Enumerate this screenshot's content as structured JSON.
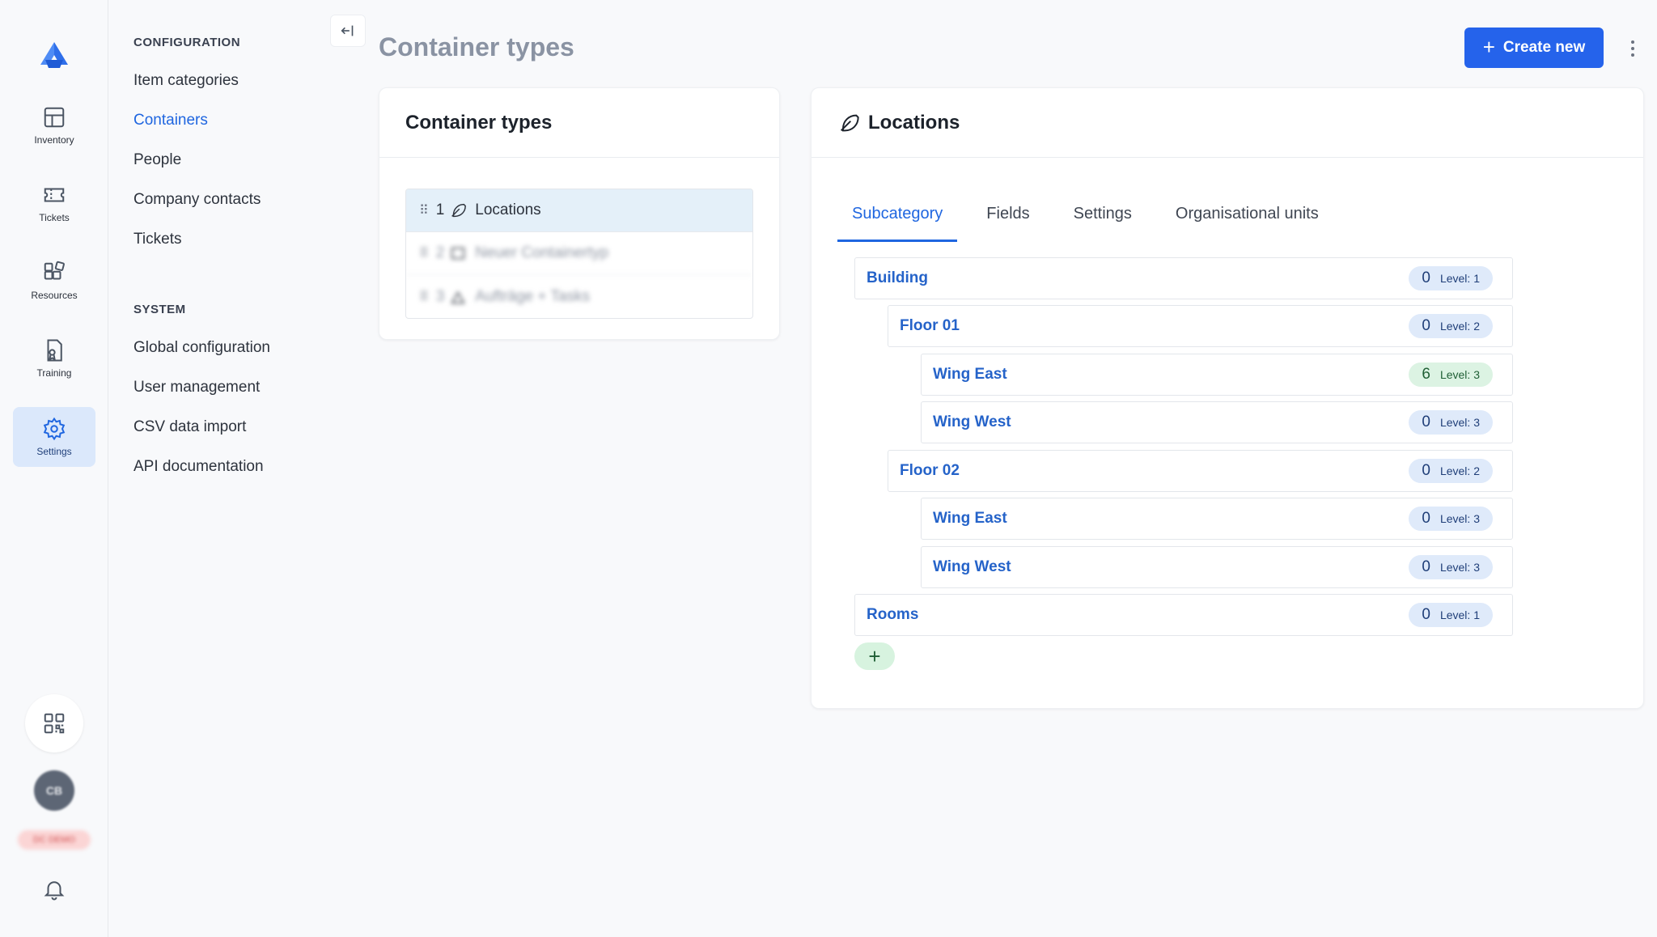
{
  "rail": {
    "items": [
      {
        "label": "Inventory"
      },
      {
        "label": "Tickets"
      },
      {
        "label": "Resources"
      },
      {
        "label": "Training"
      },
      {
        "label": "Settings"
      }
    ],
    "avatar_initials": "CB",
    "badge_text": "DC DEMO"
  },
  "subnav": {
    "configuration_title": "CONFIGURATION",
    "configuration_items": [
      "Item categories",
      "Containers",
      "People",
      "Company contacts",
      "Tickets"
    ],
    "system_title": "SYSTEM",
    "system_items": [
      "Global configuration",
      "User management",
      "CSV data import",
      "API documentation"
    ]
  },
  "header": {
    "title": "Container types",
    "create_label": "Create new"
  },
  "types_card": {
    "title": "Container types",
    "rows": [
      {
        "num": "1",
        "label": "Locations"
      },
      {
        "num": "2",
        "label": "Neuer Containertyp"
      },
      {
        "num": "3",
        "label": "Aufträge + Tasks"
      }
    ]
  },
  "detail_card": {
    "title": "Locations",
    "tabs": [
      "Subcategory",
      "Fields",
      "Settings",
      "Organisational units"
    ],
    "nodes": [
      {
        "name": "Building",
        "count": "0",
        "level": "Level: 1"
      },
      {
        "name": "Floor 01",
        "count": "0",
        "level": "Level: 2"
      },
      {
        "name": "Wing East",
        "count": "6",
        "level": "Level: 3"
      },
      {
        "name": "Wing West",
        "count": "0",
        "level": "Level: 3"
      },
      {
        "name": "Floor 02",
        "count": "0",
        "level": "Level: 2"
      },
      {
        "name": "Wing East",
        "count": "0",
        "level": "Level: 3"
      },
      {
        "name": "Wing West",
        "count": "0",
        "level": "Level: 3"
      },
      {
        "name": "Rooms",
        "count": "0",
        "level": "Level: 1"
      }
    ],
    "add_label": "+"
  },
  "colors": {
    "accent": "#2563eb",
    "active_bg": "#dbe8fb",
    "pill_blue": "#dfeafa",
    "pill_green": "#dcf3e3"
  }
}
